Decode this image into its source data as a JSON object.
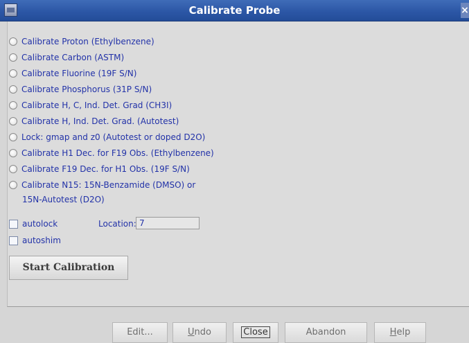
{
  "window": {
    "title": "Calibrate Probe",
    "close_glyph": "×"
  },
  "options": [
    "Calibrate Proton (Ethylbenzene)",
    "Calibrate Carbon (ASTM)",
    "Calibrate Fluorine (19F S/N)",
    "Calibrate Phosphorus (31P S/N)",
    "Calibrate H, C, Ind. Det. Grad (CH3I)",
    "Calibrate H, Ind. Det. Grad. (Autotest)",
    "Lock: gmap and z0 (Autotest or doped D2O)",
    "Calibrate H1 Dec. for F19 Obs. (Ethylbenzene)",
    "Calibrate F19 Dec. for H1 Obs. (19F S/N)",
    "Calibrate N15: 15N-Benzamide (DMSO) or"
  ],
  "option_continuation": "15N-Autotest (D2O)",
  "autolock_label": "autolock",
  "autoshim_label": "autoshim",
  "location_label": "Location:",
  "location_value": "7",
  "start_button": "Start Calibration",
  "bottom_buttons": {
    "edit": "Edit...",
    "undo_u": "U",
    "undo_rest": "ndo",
    "close": "Close",
    "abandon": "Abandon",
    "help_h": "H",
    "help_rest": "elp"
  }
}
